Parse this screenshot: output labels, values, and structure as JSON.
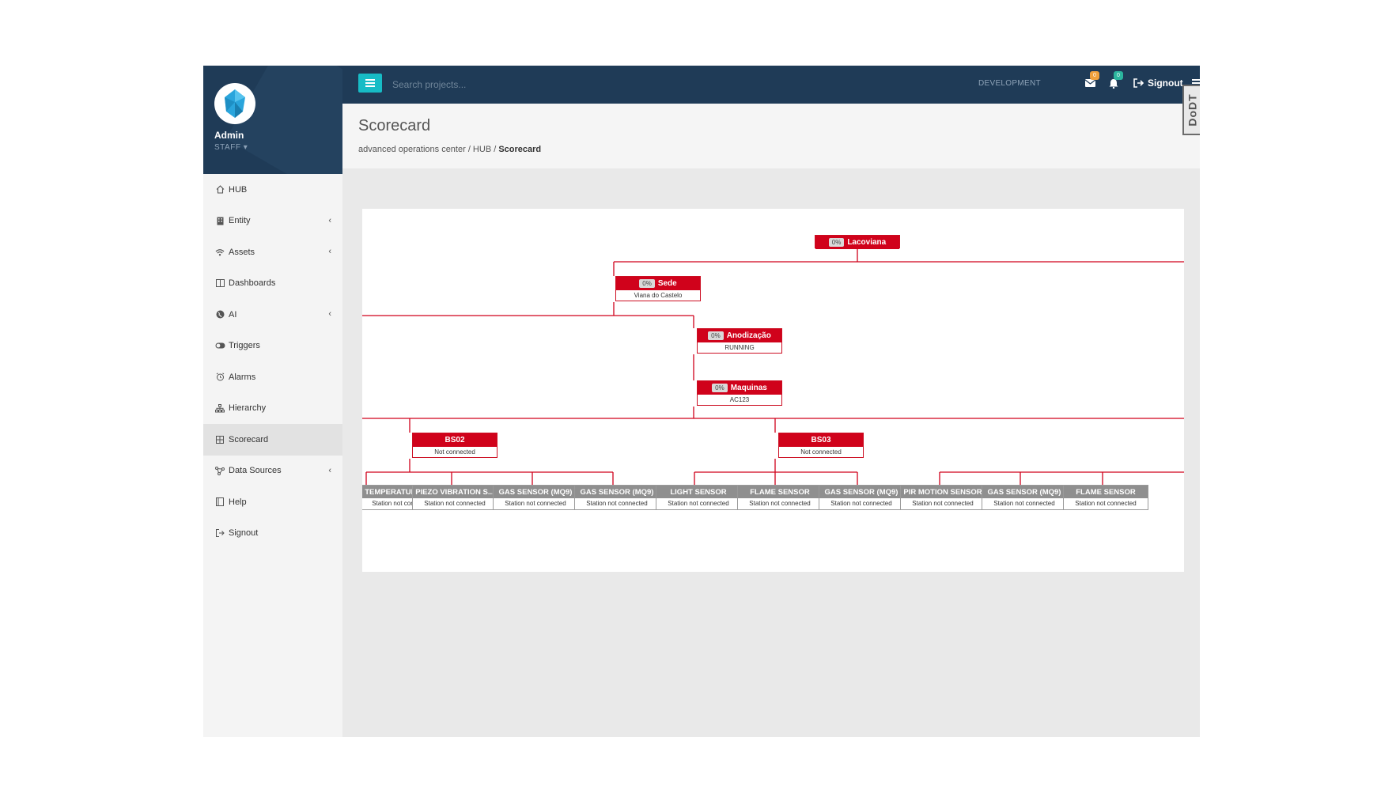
{
  "profile": {
    "name": "Admin",
    "role": "STAFF ▾"
  },
  "sidebar": {
    "items": [
      {
        "label": "HUB",
        "icon": "home-icon"
      },
      {
        "label": "Entity",
        "icon": "building-icon",
        "chevron": "‹"
      },
      {
        "label": "Assets",
        "icon": "wifi-icon",
        "chevron": "‹"
      },
      {
        "label": "Dashboards",
        "icon": "columns-icon"
      },
      {
        "label": "AI",
        "icon": "globe-icon",
        "chevron": "‹"
      },
      {
        "label": "Triggers",
        "icon": "toggle-icon"
      },
      {
        "label": "Alarms",
        "icon": "alarm-clock-icon"
      },
      {
        "label": "Hierarchy",
        "icon": "sitemap-icon"
      },
      {
        "label": "Scorecard",
        "icon": "table-icon",
        "active": true
      },
      {
        "label": "Data Sources",
        "icon": "share-nodes-icon",
        "chevron": "‹"
      },
      {
        "label": "Help",
        "icon": "book-icon"
      },
      {
        "label": "Signout",
        "icon": "signout-icon"
      }
    ]
  },
  "topbar": {
    "search_placeholder": "Search projects...",
    "environment": "DEVELOPMENT",
    "mail_badge": "0",
    "bell_badge": "0",
    "signout": "Signout",
    "colors": {
      "nav": "#1f3b57",
      "toggle": "#17bcc6",
      "mail_badge": "#f0a13c",
      "bell_badge": "#2bb59e"
    }
  },
  "ribbon": {
    "text": "DoDT"
  },
  "header": {
    "title": "Scorecard",
    "breadcrumb": {
      "path": "advanced operations center / HUB  /",
      "current": "Scorecard"
    }
  },
  "tree": {
    "colors": {
      "node": "#d0021b",
      "leaf": "#8f8f8f",
      "line": "#d0021b"
    },
    "nodes": [
      {
        "id": "lacoviana",
        "pct": "0%",
        "title": "Lacoviana",
        "sub": ""
      },
      {
        "id": "sede",
        "pct": "0%",
        "title": "Sede",
        "sub": "Viana do Castelo"
      },
      {
        "id": "anodizacao",
        "pct": "0%",
        "title": "Anodização",
        "sub": "RUNNING"
      },
      {
        "id": "maquinas",
        "pct": "0%",
        "title": "Maquinas",
        "sub": "AC123"
      },
      {
        "id": "bs02",
        "pct": "",
        "title": "BS02",
        "sub": "Not connected"
      },
      {
        "id": "bs03",
        "pct": "",
        "title": "BS03",
        "sub": "Not connected"
      }
    ],
    "leaves": [
      {
        "title": "TEMPERATURE AN...",
        "sub": "Station not connected"
      },
      {
        "title": "PIEZO VIBRATION S...",
        "sub": "Station not connected"
      },
      {
        "title": "GAS SENSOR (MQ9)",
        "sub": "Station not connected"
      },
      {
        "title": "GAS SENSOR (MQ9)",
        "sub": "Station not connected"
      },
      {
        "title": "LIGHT SENSOR",
        "sub": "Station not connected"
      },
      {
        "title": "FLAME SENSOR",
        "sub": "Station not connected"
      },
      {
        "title": "GAS SENSOR (MQ9)",
        "sub": "Station not connected"
      },
      {
        "title": "PIR MOTION SENSOR",
        "sub": "Station not connected"
      },
      {
        "title": "GAS SENSOR (MQ9)",
        "sub": "Station not connected"
      },
      {
        "title": "FLAME SENSOR",
        "sub": "Station not connected"
      }
    ]
  }
}
